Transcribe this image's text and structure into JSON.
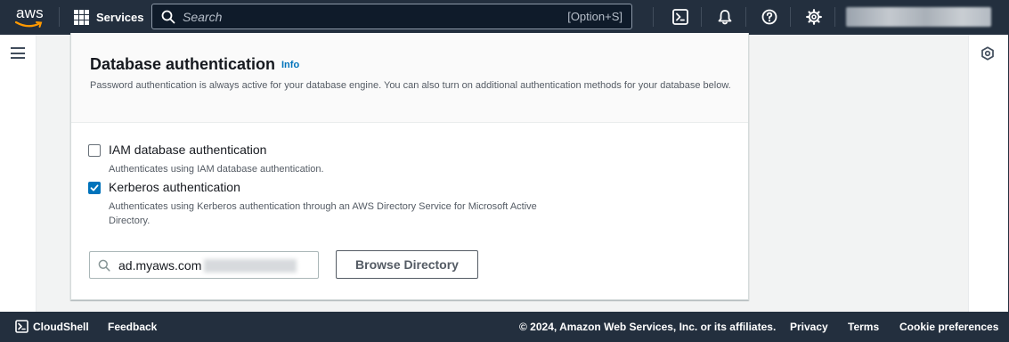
{
  "topbar": {
    "logo_text": "aws",
    "services_label": "Services",
    "search_placeholder": "Search",
    "search_shortcut": "[Option+S]",
    "icons": [
      "cloudshell-icon",
      "notifications-icon",
      "help-icon",
      "settings-icon"
    ],
    "colors": {
      "background": "#232f3e",
      "logo_smile": "#ff9900"
    }
  },
  "panel": {
    "title": "Database authentication",
    "info_label": "Info",
    "description": "Password authentication is always active for your database engine. You can also turn on additional authentication methods for your database below.",
    "options": [
      {
        "label": "IAM database authentication",
        "description": "Authenticates using IAM database authentication.",
        "checked": false
      },
      {
        "label": "Kerberos authentication",
        "description": "Authenticates using Kerberos authentication through an AWS Directory Service for Microsoft Active Directory.",
        "checked": true
      }
    ],
    "directory_value": "ad.myaws.com",
    "browse_button_label": "Browse Directory",
    "colors": {
      "accent": "#0073bb"
    }
  },
  "footer": {
    "cloudshell_label": "CloudShell",
    "feedback_label": "Feedback",
    "copyright": "© 2024, Amazon Web Services, Inc. or its affiliates.",
    "privacy_label": "Privacy",
    "terms_label": "Terms",
    "cookie_label": "Cookie preferences"
  }
}
